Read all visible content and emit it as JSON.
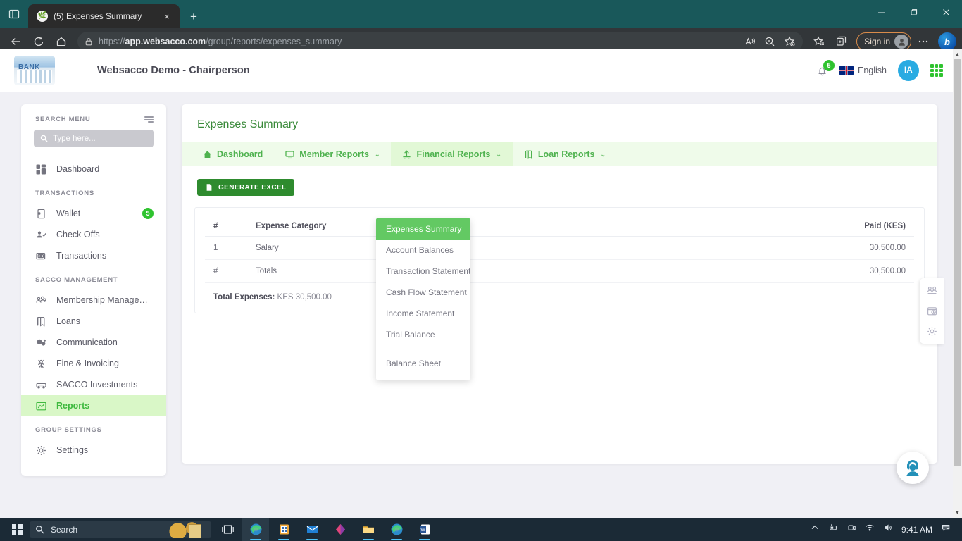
{
  "browser": {
    "tab": {
      "title": "(5) Expenses Summary",
      "favicon": "leaf-icon",
      "close": "×"
    },
    "new_tab": "+",
    "url_prefix": "https://",
    "url_domain": "app.websacco.com",
    "url_path": "/group/reports/expenses_summary",
    "sign_in_label": "Sign in",
    "window_controls": {
      "minimize": "minimize-icon",
      "maximize": "maximize-icon",
      "close": "close-icon"
    },
    "toolbar_icons": [
      "back-icon",
      "refresh-icon",
      "home-icon",
      "read-aloud-icon",
      "zoom-icon",
      "add-favorite-icon",
      "favorites-icon",
      "collections-icon",
      "settings-more-icon",
      "bing-chat-icon"
    ]
  },
  "app_header": {
    "logo_text": "BANK",
    "title": "Websacco Demo - Chairperson",
    "notification_count": "5",
    "language": "English",
    "avatar_initials": "IA"
  },
  "sidebar": {
    "search_title": "SEARCH MENU",
    "search_placeholder": "Type here...",
    "search_value": "",
    "groups": [
      {
        "label": "",
        "items": [
          {
            "label": "Dashboard",
            "icon": "dashboard-icon",
            "badge": "",
            "active": false
          }
        ]
      },
      {
        "label": "TRANSACTIONS",
        "items": [
          {
            "label": "Wallet",
            "icon": "wallet-icon",
            "badge": "5",
            "active": false
          },
          {
            "label": "Check Offs",
            "icon": "check-offs-icon",
            "badge": "",
            "active": false
          },
          {
            "label": "Transactions",
            "icon": "transactions-icon",
            "badge": "",
            "active": false
          }
        ]
      },
      {
        "label": "SACCO MANAGEMENT",
        "items": [
          {
            "label": "Membership Managem...",
            "icon": "members-icon",
            "badge": "",
            "active": false
          },
          {
            "label": "Loans",
            "icon": "loans-icon",
            "badge": "",
            "active": false
          },
          {
            "label": "Communication",
            "icon": "communication-icon",
            "badge": "",
            "active": false
          },
          {
            "label": "Fine & Invoicing",
            "icon": "fine-invoicing-icon",
            "badge": "",
            "active": false
          },
          {
            "label": "SACCO Investments",
            "icon": "investments-icon",
            "badge": "",
            "active": false
          },
          {
            "label": "Reports",
            "icon": "reports-icon",
            "badge": "",
            "active": true
          }
        ]
      },
      {
        "label": "GROUP SETTINGS",
        "items": [
          {
            "label": "Settings",
            "icon": "gear-icon",
            "badge": "",
            "active": false
          }
        ]
      }
    ]
  },
  "main": {
    "page_title": "Expenses Summary",
    "tabs": [
      {
        "label": "Dashboard",
        "icon": "home-icon",
        "caret": "",
        "open": false
      },
      {
        "label": "Member Reports",
        "icon": "monitor-icon",
        "caret": "⌄",
        "open": false
      },
      {
        "label": "Financial Reports",
        "icon": "finance-icon",
        "caret": "⌄",
        "open": true
      },
      {
        "label": "Loan Reports",
        "icon": "loan-doc-icon",
        "caret": "⌄",
        "open": false
      }
    ],
    "dropdown": {
      "items": [
        {
          "label": "Expenses Summary",
          "selected": true,
          "separator_after": false
        },
        {
          "label": "Account Balances",
          "selected": false,
          "separator_after": false
        },
        {
          "label": "Transaction Statement",
          "selected": false,
          "separator_after": false
        },
        {
          "label": "Cash Flow Statement",
          "selected": false,
          "separator_after": false
        },
        {
          "label": "Income Statement",
          "selected": false,
          "separator_after": false
        },
        {
          "label": "Trial Balance",
          "selected": false,
          "separator_after": true
        },
        {
          "label": "Balance Sheet",
          "selected": false,
          "separator_after": false
        }
      ]
    },
    "generate_excel_label": "GENERATE EXCEL",
    "table": {
      "headers": [
        "#",
        "Expense Category",
        "Paid (KES)"
      ],
      "rows": [
        [
          "1",
          "Salary",
          "30,500.00"
        ],
        [
          "#",
          "Totals",
          "30,500.00"
        ]
      ]
    },
    "total_label": "Total Expenses:",
    "total_value": "KES 30,500.00",
    "rail_icons": [
      "members-rail-icon",
      "calendar-clock-rail-icon",
      "gear-rail-icon"
    ],
    "chat_icon": "support-agent-icon"
  },
  "taskbar": {
    "search_placeholder": "Search",
    "apps": [
      "task-view-icon",
      "edge-icon",
      "store-icon",
      "mail-icon",
      "office-icon",
      "file-explorer-icon",
      "edge2-icon",
      "word-icon"
    ],
    "tray_icons": [
      "chevron-up-icon",
      "battery-charging-icon",
      "camera-icon",
      "wifi-icon",
      "volume-icon"
    ],
    "clock": "9:41 AM",
    "notification_icon": "notification-center-icon"
  },
  "colors": {
    "accent_green": "#3fb93f",
    "tabbar_bg": "#effbea",
    "dropdown_selected": "#63c963",
    "excel_button": "#2e8b2e",
    "badge_green": "#2fc32f",
    "avatar_blue": "#29abe2",
    "page_bg": "#f0f0f5",
    "browser_chrome": "#1b5e60"
  }
}
